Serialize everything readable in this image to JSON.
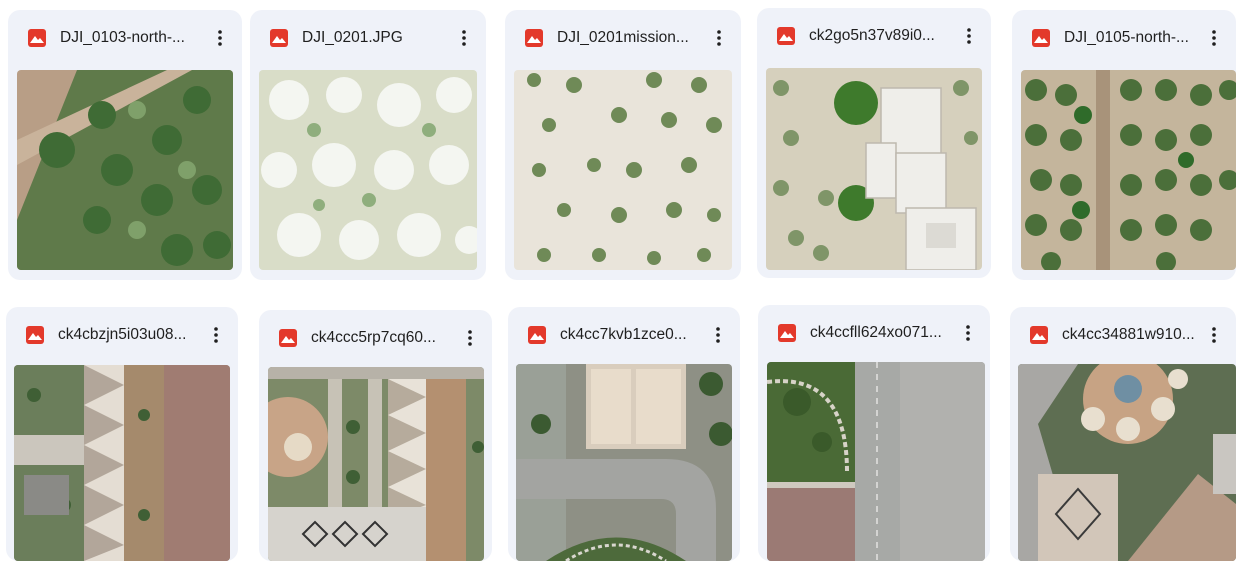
{
  "files": [
    {
      "name": "DJI_0103-north-...",
      "thumbnail": "aerial-palm-grove-road"
    },
    {
      "name": "DJI_0201.JPG",
      "thumbnail": "aerial-white-palms"
    },
    {
      "name": "DJI_0201mission...",
      "thumbnail": "aerial-sparse-palms-sand"
    },
    {
      "name": "ck2go5n37v89i0...",
      "thumbnail": "aerial-palms-buildings"
    },
    {
      "name": "DJI_0105-north-...",
      "thumbnail": "aerial-dense-palm-rows"
    },
    {
      "name": "ck4cbzjn5i03u08...",
      "thumbnail": "aerial-shade-canopies-courtyard"
    },
    {
      "name": "ck4ccc5rp7cq60...",
      "thumbnail": "aerial-courtyard-diamond-pattern"
    },
    {
      "name": "ck4cc7kvb1zce0...",
      "thumbnail": "aerial-road-tents-garden"
    },
    {
      "name": "ck4ccfll624xo071...",
      "thumbnail": "aerial-street-roundabout-garden"
    },
    {
      "name": "ck4cc34881w910...",
      "thumbnail": "aerial-plaza-umbrellas"
    }
  ],
  "icons": {
    "file_type": "image-file-icon",
    "menu": "more-vert-icon"
  },
  "colors": {
    "card_bg": "#eff2f9",
    "image_icon": "#e3392b",
    "text": "#1f1f1f"
  }
}
